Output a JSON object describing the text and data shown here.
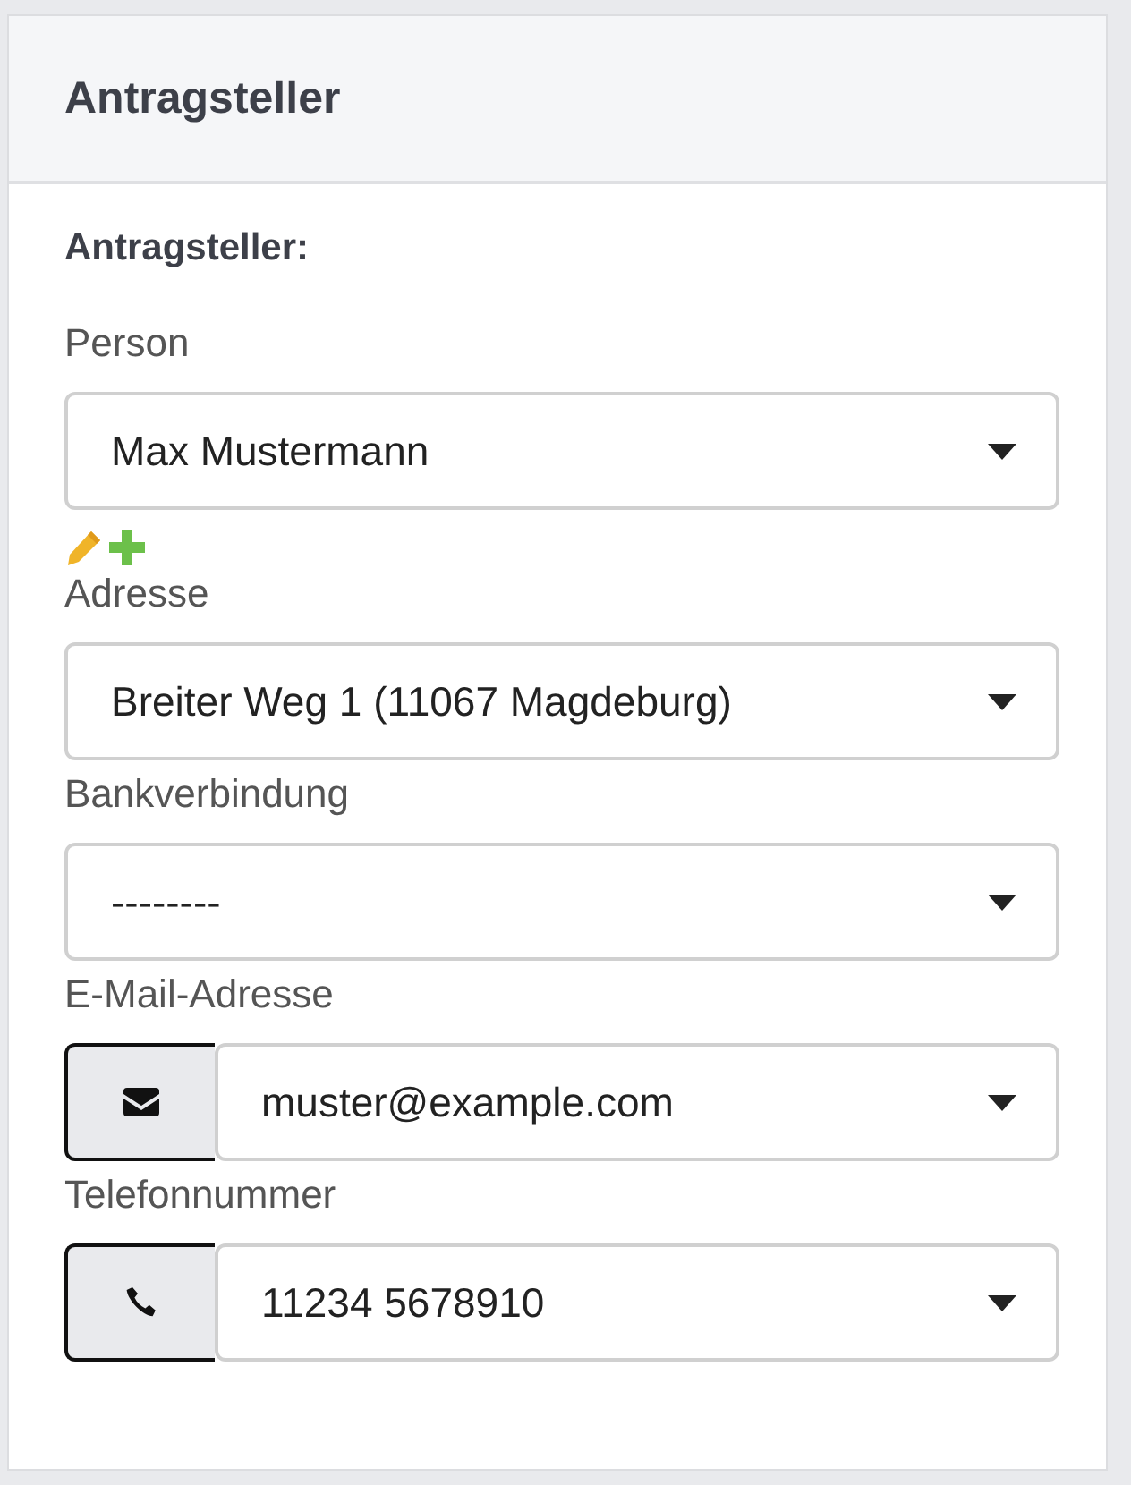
{
  "panel": {
    "title": "Antragsteller"
  },
  "section_heading": "Antragsteller:",
  "fields": [
    {
      "kind": "select",
      "label": "Person",
      "value": "Max Mustermann",
      "actions": true
    },
    {
      "kind": "select",
      "label": "Adresse",
      "value": "Breiter Weg 1 (11067 Magdeburg)"
    },
    {
      "kind": "select",
      "label": "Bankverbindung",
      "value": "--------"
    },
    {
      "kind": "email",
      "label": "E-Mail-Adresse",
      "value": "muster@example.com"
    },
    {
      "kind": "phone",
      "label": "Telefonnummer",
      "value": "11234 5678910"
    }
  ]
}
